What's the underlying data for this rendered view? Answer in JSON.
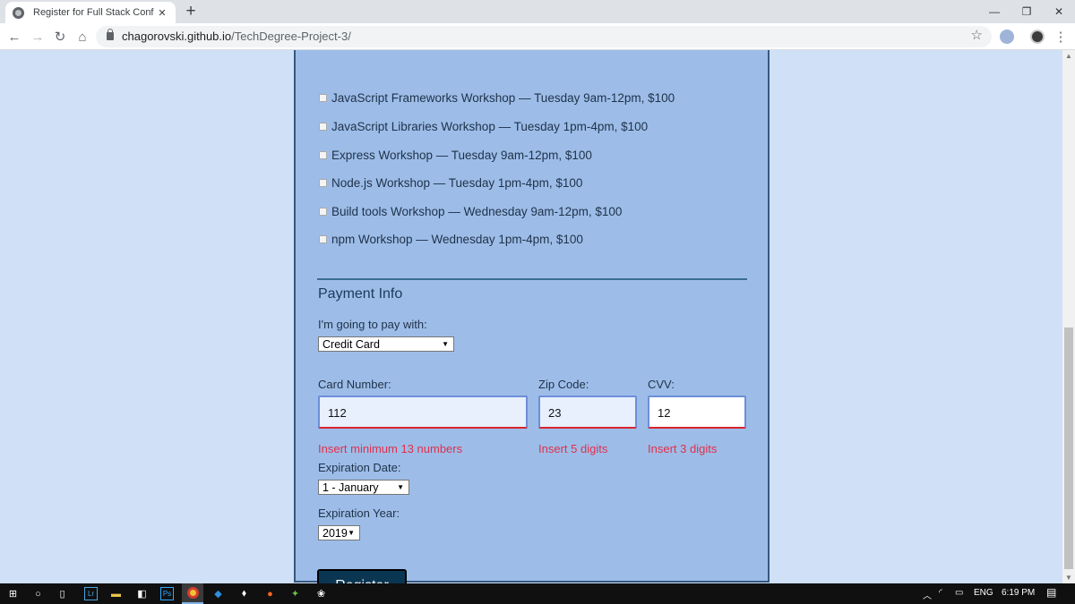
{
  "browser": {
    "tab_title": "Register for Full Stack Conf",
    "url_host": "chagorovski.github.io",
    "url_path": "/TechDegree-Project-3/"
  },
  "activities": [
    {
      "label": "JavaScript Frameworks Workshop — Tuesday 9am-12pm, $100",
      "checked": false
    },
    {
      "label": "JavaScript Libraries Workshop — Tuesday 1pm-4pm, $100",
      "checked": false
    },
    {
      "label": "Express Workshop — Tuesday 9am-12pm, $100",
      "checked": false
    },
    {
      "label": "Node.js Workshop — Tuesday 1pm-4pm, $100",
      "checked": false
    },
    {
      "label": "Build tools Workshop — Wednesday 9am-12pm, $100",
      "checked": false
    },
    {
      "label": "npm Workshop — Wednesday 1pm-4pm, $100",
      "checked": false
    }
  ],
  "payment": {
    "heading": "Payment Info",
    "pay_with_label": "I'm going to pay with:",
    "pay_with_value": "Credit Card",
    "card_number_label": "Card Number:",
    "card_number_value": "112",
    "card_number_error": "Insert minimum 13 numbers",
    "zip_label": "Zip Code:",
    "zip_value": "23",
    "zip_error": "Insert 5 digits",
    "cvv_label": "CVV:",
    "cvv_value": "12",
    "cvv_error": "Insert 3 digits",
    "exp_date_label": "Expiration Date:",
    "exp_date_value": "1 - January",
    "exp_year_label": "Expiration Year:",
    "exp_year_value": "2019",
    "register_label": "Register"
  },
  "taskbar": {
    "language": "ENG",
    "time": "6:19 PM"
  },
  "colors": {
    "page_bg": "#cfe0f7",
    "panel_bg": "#9dbde8",
    "error": "#e0304d",
    "button": "#0b3652"
  }
}
